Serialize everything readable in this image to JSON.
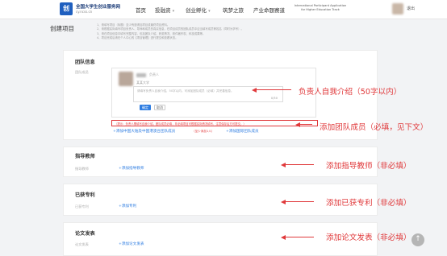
{
  "header": {
    "site_name": "全国大学生创业服务网",
    "site_url": "cy.ncss.cn",
    "nav": [
      "首页",
      "投融资",
      "创业孵化",
      "筑梦之旅",
      "产业命题赛道"
    ],
    "intl_text": "International Participant Application for Higher Education Track",
    "user_suffix": "退出"
  },
  "page": {
    "title": "创建项目",
    "notes": [
      "1、请填写项目（标题）至少有邀请加项目或最终项目资料。",
      "2、请根据实际填写项目负责人、导师和成员的真实信息，在项目成员的团队成员中应当填写成员等姓名（同时为学号）。",
      "3、请在项目信息中填写完整内容，包括团队介绍、获奖情况、软件著作权、科技成果等。",
      "4、项目完成后请在个人中心的【项目管理】进行提交和查看状态。"
    ]
  },
  "team": {
    "title": "团队信息",
    "label": "团队成员",
    "member_role": "负责人",
    "member_school": "某某大学",
    "intro_placeholder": "请填写负责人自我介绍，50字以内。可添加团队成员（必填）并完善信息。",
    "intro_count": "0/50",
    "confirm": "确定",
    "cancel": "取消",
    "warning": "（提示：负责人需填写自我介绍，团队成员必填，非必填项目可根据实际情况填写，注意保存后方可提交。）",
    "add_member": "+添加中国大陆及中国港澳台团队成员",
    "add_member_note": "（至少添加1人）",
    "add_intl_member": "+添加国际团队成员"
  },
  "mentor": {
    "title": "指导教师",
    "label": "指导教师",
    "add": "+添加指导教师"
  },
  "patent": {
    "title": "已获专利",
    "label": "已获专利",
    "add": "+添加专利"
  },
  "paper": {
    "title": "论文发表",
    "label": "论文发表",
    "add": "+添加论文发表"
  },
  "annotations": {
    "intro": "负责人自我介绍（50字以内）",
    "member": "添加团队成员（必填，见下文）",
    "mentor": "添加指导教师（非必填）",
    "patent": "添加已获专利（非必填）",
    "paper": "添加论文发表（非必填）"
  },
  "icons": {
    "scroll_top": "arrow-up-icon"
  },
  "colors": {
    "accent": "#2f7de1",
    "annotation": "#e0393b"
  }
}
